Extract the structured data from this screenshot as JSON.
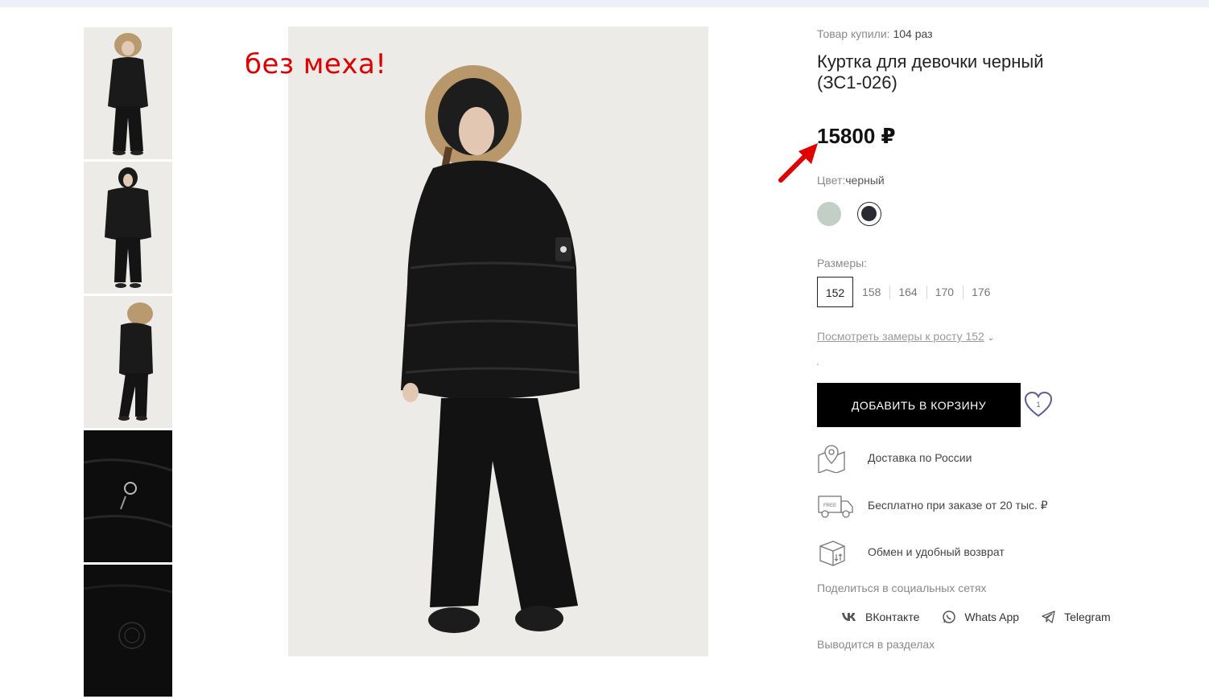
{
  "gallery": {
    "thumbnails": [
      {
        "label": "photo-front-fur-hood",
        "tone": "light"
      },
      {
        "label": "photo-front-hood",
        "tone": "light"
      },
      {
        "label": "photo-back-fur-hood",
        "tone": "light"
      },
      {
        "label": "photo-detail-pocket",
        "tone": "dark"
      },
      {
        "label": "photo-detail-logo",
        "tone": "dark"
      }
    ]
  },
  "annotation": {
    "text": "без меха!",
    "color": "#e00000"
  },
  "product": {
    "bought_label": "Товар купили:",
    "bought_count": "104 раз",
    "title": "Куртка для девочки черный (ЗС1-026)",
    "price": "15800 ₽",
    "color_label": "Цвет:",
    "color_value": "черный",
    "swatches": [
      {
        "name": "mint",
        "hex": "#c2cfc7",
        "selected": false
      },
      {
        "name": "black",
        "hex": "#2a2a33",
        "selected": true
      }
    ],
    "sizes_label": "Размеры:",
    "sizes": [
      "152",
      "158",
      "164",
      "170",
      "176"
    ],
    "selected_size": "152",
    "measure_link": "Посмотреть замеры к росту 152",
    "cart_button": "ДОБАВИТЬ В КОРЗИНУ",
    "favorite_count": "1"
  },
  "features": [
    {
      "icon": "map-pin-icon",
      "text": "Доставка по России"
    },
    {
      "icon": "delivery-truck-icon",
      "text": "Бесплатно при заказе от 20 тыс. ₽"
    },
    {
      "icon": "return-box-icon",
      "text": "Обмен и удобный возврат"
    }
  ],
  "share": {
    "label": "Поделиться в социальных сетях",
    "items": [
      {
        "icon": "vk-icon",
        "label": "ВКонтакте"
      },
      {
        "icon": "whatsapp-icon",
        "label": "Whats App"
      },
      {
        "icon": "telegram-icon",
        "label": "Telegram"
      }
    ]
  },
  "sections_label": "Выводится в разделах"
}
